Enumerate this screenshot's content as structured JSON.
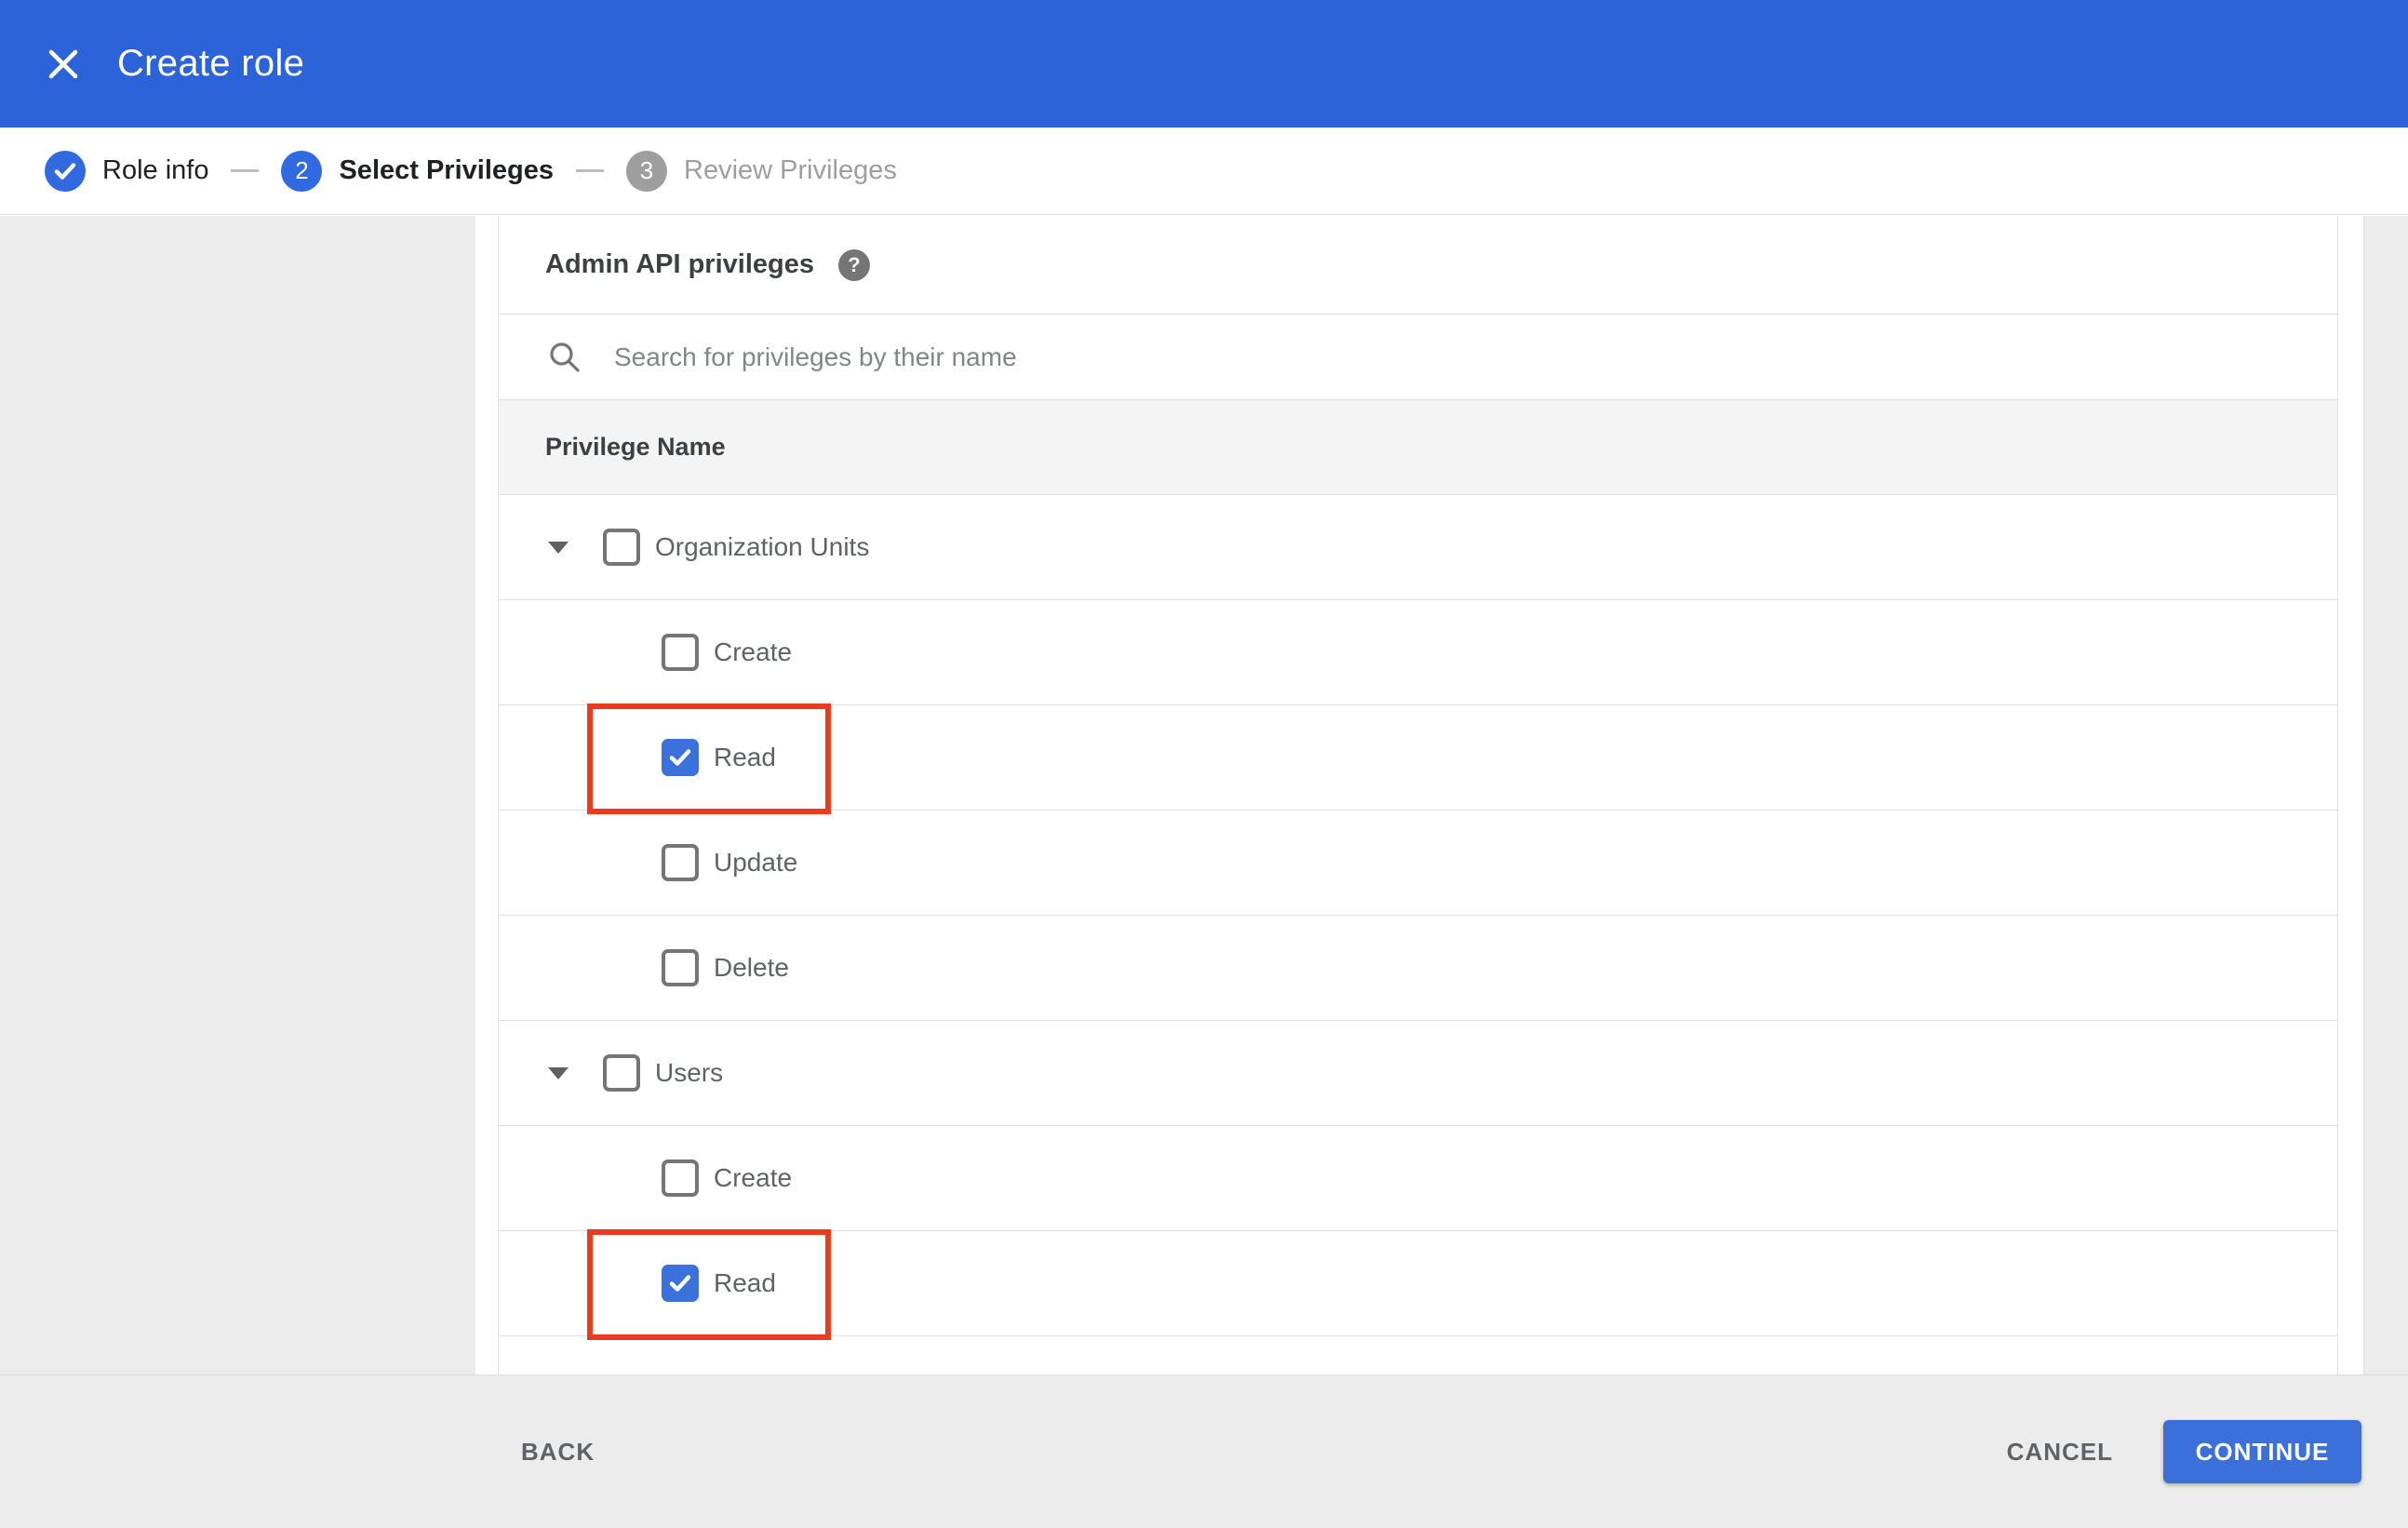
{
  "app_bar": {
    "title": "Create role",
    "close_icon": "x-icon",
    "bg_color": "#2c63d9"
  },
  "stepper": {
    "steps": [
      {
        "number": "1",
        "label": "Role info",
        "state": "completed",
        "icon": "checkmark-icon"
      },
      {
        "number": "2",
        "label": "Select Privileges",
        "state": "active"
      },
      {
        "number": "3",
        "label": "Review Privileges",
        "state": "upcoming"
      }
    ]
  },
  "panel": {
    "heading": "Admin API privileges",
    "help_icon": "?",
    "search": {
      "placeholder": "Search for privileges by their name",
      "value": "",
      "icon": "magnifier-icon"
    },
    "table": {
      "header": "Privilege Name",
      "rows": [
        {
          "label": "Organization Units",
          "type": "parent",
          "expanded": true,
          "checked": false,
          "highlighted": false
        },
        {
          "label": "Create",
          "type": "child",
          "checked": false,
          "highlighted": false
        },
        {
          "label": "Read",
          "type": "child",
          "checked": true,
          "highlighted": true
        },
        {
          "label": "Update",
          "type": "child",
          "checked": false,
          "highlighted": false
        },
        {
          "label": "Delete",
          "type": "child",
          "checked": false,
          "highlighted": false
        },
        {
          "label": "Users",
          "type": "parent",
          "expanded": true,
          "checked": false,
          "highlighted": false
        },
        {
          "label": "Create",
          "type": "child",
          "checked": false,
          "highlighted": false
        },
        {
          "label": "Read",
          "type": "child",
          "checked": true,
          "highlighted": true
        }
      ]
    }
  },
  "footer": {
    "back_label": "BACK",
    "cancel_label": "CANCEL",
    "continue_label": "CONTINUE"
  },
  "colors": {
    "header_blue": "#2c63d9",
    "step_blue": "#3169e1",
    "checkbox_blue": "#3a71dd",
    "continue_blue": "#3b6fd9",
    "highlight_red": "#ea3b21",
    "inactive_gray": "#9e9e9e",
    "surface_gray": "#ececec",
    "border_gray": "#e0e0e0"
  }
}
